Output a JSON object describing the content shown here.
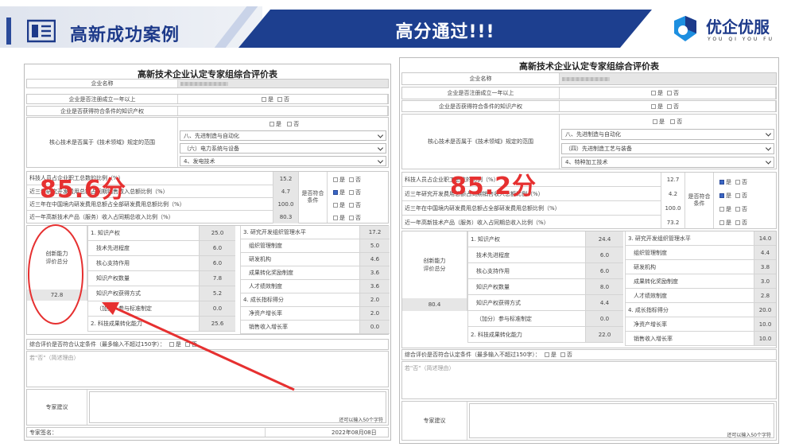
{
  "header": {
    "left_title": "高新成功案例",
    "center_title": "高分通过!!!",
    "brand_name": "优企优服",
    "brand_sub": "YOU QI YOU FU"
  },
  "left": {
    "title": "高新技术企业认定专家组综合评价表",
    "score_overlay": "85.6分",
    "company_label": "企业名称",
    "q_year": "企业是否注册成立一年以上",
    "q_ip": "企业是否获得符合条件的知识产权",
    "q_field": "核心技术是否属于《技术领域》规定的范围",
    "field_sel1": "八、先进制造与自动化",
    "field_sel2": "（六）电力系统与设备",
    "field_sel3": "4、发电技术",
    "ratio_rows": [
      {
        "label": "科技人员占企业职工总数的比例（%）",
        "value": "15.2"
      },
      {
        "label": "近三年研究开发费用总额占同期销售收入总额比例（%）",
        "value": "4.7"
      },
      {
        "label": "近三年在中国境内研发费用总额占全部研发费用总额比例（%）",
        "value": "100.0"
      },
      {
        "label": "近一年高新技术产品（服务）收入占同期总收入比例（%）",
        "value": "80.3"
      }
    ],
    "meets_label": "是否符合条件",
    "innov_label": "创新能力评价总分",
    "innov_total": "72.8",
    "scores_left": [
      {
        "label": "1. 知识产权",
        "value": "25.0"
      },
      {
        "label": "技术先进程度",
        "value": "6.0"
      },
      {
        "label": "核心支持作用",
        "value": "6.0"
      },
      {
        "label": "知识产权数量",
        "value": "7.8"
      },
      {
        "label": "知识产权获得方式",
        "value": "5.2"
      },
      {
        "label": "（加分）参与标准制定",
        "value": "0.0"
      },
      {
        "label": "2. 科技成果转化能力",
        "value": "25.6"
      }
    ],
    "scores_right": [
      {
        "label": "3. 研究开发组织管理水平",
        "value": "17.2"
      },
      {
        "label": "组织管理制度",
        "value": "5.0"
      },
      {
        "label": "研发机构",
        "value": "4.6"
      },
      {
        "label": "成果转化奖励制度",
        "value": "3.6"
      },
      {
        "label": "人才绩效制度",
        "value": "3.6"
      },
      {
        "label": "4. 成长指标得分",
        "value": "2.0"
      },
      {
        "label": "净资产增长率",
        "value": "2.0"
      },
      {
        "label": "销售收入增长率",
        "value": "0.0"
      }
    ],
    "overall_q": "综合评价是否符合认定条件（最多输入不超过150字）：",
    "no_reason": "若\"否\"（简述理由）",
    "expert_suggest": "专家建议",
    "char_limit": "还可以输入50个字符",
    "expert_sign": "专家签名：",
    "date": "2022年08月08日"
  },
  "right": {
    "title": "高新技术企业认定专家组综合评价表",
    "score_overlay": "85.2分",
    "company_label": "企业名称",
    "q_year": "企业是否注册成立一年以上",
    "q_ip": "企业是否获得符合条件的知识产权",
    "q_field": "核心技术是否属于《技术领域》规定的范围",
    "field_sel1": "八、先进制造与自动化",
    "field_sel2": "（四）先进制造工艺与装备",
    "field_sel3": "4、特种加工技术",
    "ratio_rows": [
      {
        "label": "科技人员占企业职工总数的比例（%）",
        "value": "12.7"
      },
      {
        "label": "近三年研究开发费用总额占同期销售收入总额比例（%）",
        "value": "4.2"
      },
      {
        "label": "近三年在中国境内研发费用总额占全部研发费用总额比例（%）",
        "value": "100.0"
      },
      {
        "label": "近一年高新技术产品（服务）收入占同期总收入比例（%）",
        "value": "73.2"
      }
    ],
    "meets_label": "是否符合条件",
    "innov_label": "创新能力评价总分",
    "innov_total": "80.4",
    "scores_left": [
      {
        "label": "1. 知识产权",
        "value": "24.4"
      },
      {
        "label": "技术先进程度",
        "value": "6.0"
      },
      {
        "label": "核心支持作用",
        "value": "6.0"
      },
      {
        "label": "知识产权数量",
        "value": "8.0"
      },
      {
        "label": "知识产权获得方式",
        "value": "4.4"
      },
      {
        "label": "（加分）参与标准制定",
        "value": "0.0"
      },
      {
        "label": "2. 科技成果转化能力",
        "value": "22.0"
      }
    ],
    "scores_right": [
      {
        "label": "3. 研究开发组织管理水平",
        "value": "14.0"
      },
      {
        "label": "组织管理制度",
        "value": "4.4"
      },
      {
        "label": "研发机构",
        "value": "3.8"
      },
      {
        "label": "成果转化奖励制度",
        "value": "3.0"
      },
      {
        "label": "人才绩效制度",
        "value": "2.8"
      },
      {
        "label": "4. 成长指标得分",
        "value": "20.0"
      },
      {
        "label": "净资产增长率",
        "value": "10.0"
      },
      {
        "label": "销售收入增长率",
        "value": "10.0"
      }
    ],
    "overall_q": "综合评价是否符合认定条件（最多输入不超过150字）：",
    "no_reason": "若\"否\"（简述理由）",
    "expert_suggest": "专家建议",
    "char_limit": "还可以输入50个字符"
  },
  "labels": {
    "yes": "是",
    "no": "否"
  },
  "colors": {
    "brand_blue": "#1d3f8f",
    "score_red": "#e63030",
    "checkbox_on": "#3a66c4"
  }
}
